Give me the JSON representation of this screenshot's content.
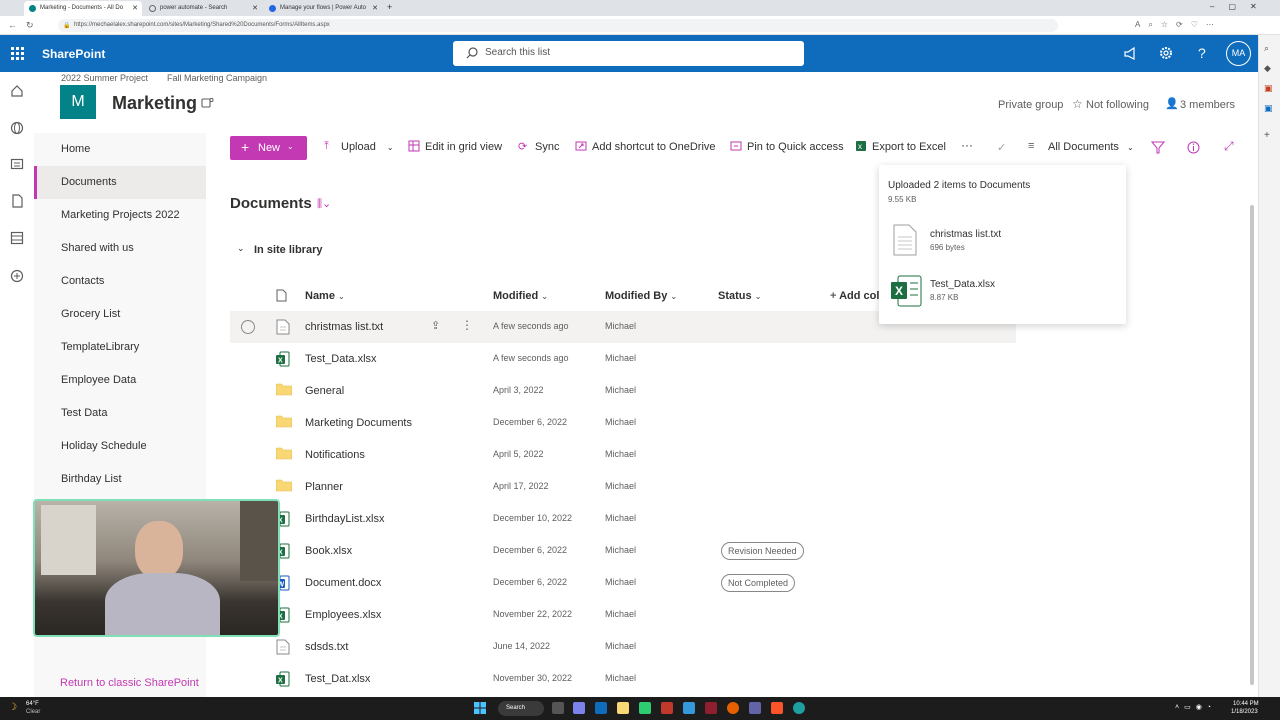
{
  "browser": {
    "tabs": [
      {
        "title": "Marketing - Documents - All Do",
        "active": true
      },
      {
        "title": "power automate - Search",
        "active": false
      },
      {
        "title": "Manage your flows | Power Auto",
        "active": false
      }
    ],
    "url": "https://mechaelalex.sharepoint.com/sites/Marketing/Shared%20Documents/Forms/AllItems.aspx"
  },
  "suite": {
    "app_name": "SharePoint",
    "search_placeholder": "Search this list",
    "avatar_initials": "MA",
    "brand_color": "#0f6cbd"
  },
  "site": {
    "breadcrumbs": [
      "2022 Summer Project",
      "Fall Marketing Campaign"
    ],
    "logo_letter": "M",
    "title": "Marketing",
    "privacy": "Private group",
    "follow": "Not following",
    "members": "3 members"
  },
  "nav": {
    "items": [
      "Home",
      "Documents",
      "Marketing Projects 2022",
      "Shared with us",
      "Contacts",
      "Grocery List",
      "TemplateLibrary",
      "Employee Data",
      "Test Data",
      "Holiday Schedule",
      "Birthday List"
    ],
    "active": "Documents",
    "return_link": "Return to classic SharePoint"
  },
  "commands": {
    "new": "New",
    "upload": "Upload",
    "edit_grid": "Edit in grid view",
    "sync": "Sync",
    "add_shortcut": "Add shortcut to OneDrive",
    "pin": "Pin to Quick access",
    "export": "Export to Excel",
    "more": "···",
    "view": "All Documents"
  },
  "library": {
    "title": "Documents",
    "group": "In site library",
    "columns": [
      "Name",
      "Modified",
      "Modified By",
      "Status",
      "Add col"
    ],
    "rows": [
      {
        "name": "christmas list.txt",
        "type": "txt",
        "modified": "A few seconds ago",
        "by": "Michael",
        "status": ""
      },
      {
        "name": "Test_Data.xlsx",
        "type": "xlsx",
        "modified": "A few seconds ago",
        "by": "Michael",
        "status": ""
      },
      {
        "name": "General",
        "type": "folder",
        "modified": "April 3, 2022",
        "by": "Michael",
        "status": ""
      },
      {
        "name": "Marketing Documents",
        "type": "folder",
        "modified": "December 6, 2022",
        "by": "Michael",
        "status": ""
      },
      {
        "name": "Notifications",
        "type": "folder",
        "modified": "April 5, 2022",
        "by": "Michael",
        "status": ""
      },
      {
        "name": "Planner",
        "type": "folder",
        "modified": "April 17, 2022",
        "by": "Michael",
        "status": ""
      },
      {
        "name": "BirthdayList.xlsx",
        "type": "xlsx",
        "modified": "December 10, 2022",
        "by": "Michael",
        "status": ""
      },
      {
        "name": "Book.xlsx",
        "type": "xlsx",
        "modified": "December 6, 2022",
        "by": "Michael",
        "status": "Revision Needed"
      },
      {
        "name": "Document.docx",
        "type": "docx",
        "modified": "December 6, 2022",
        "by": "Michael",
        "status": "Not Completed"
      },
      {
        "name": "Employees.xlsx",
        "type": "xlsx",
        "modified": "November 22, 2022",
        "by": "Michael",
        "status": ""
      },
      {
        "name": "sdsds.txt",
        "type": "txt",
        "modified": "June 14, 2022",
        "by": "Michael",
        "status": ""
      },
      {
        "name": "Test_Dat.xlsx",
        "type": "xlsx",
        "modified": "November 30, 2022",
        "by": "Michael",
        "status": ""
      }
    ]
  },
  "toast": {
    "title": "Uploaded 2 items to Documents",
    "total": "9.55 KB",
    "files": [
      {
        "name": "christmas list.txt",
        "size": "696 bytes",
        "type": "txt"
      },
      {
        "name": "Test_Data.xlsx",
        "size": "8.87 KB",
        "type": "xlsx"
      }
    ]
  },
  "taskbar": {
    "weather_temp": "64°F",
    "weather_desc": "Clear",
    "search": "Search",
    "time": "10:44 PM",
    "date": "1/18/2023"
  },
  "colors": {
    "accent": "#c239b3",
    "folder": "#f8d775",
    "excel": "#1d6f42",
    "site_logo": "#038387"
  }
}
